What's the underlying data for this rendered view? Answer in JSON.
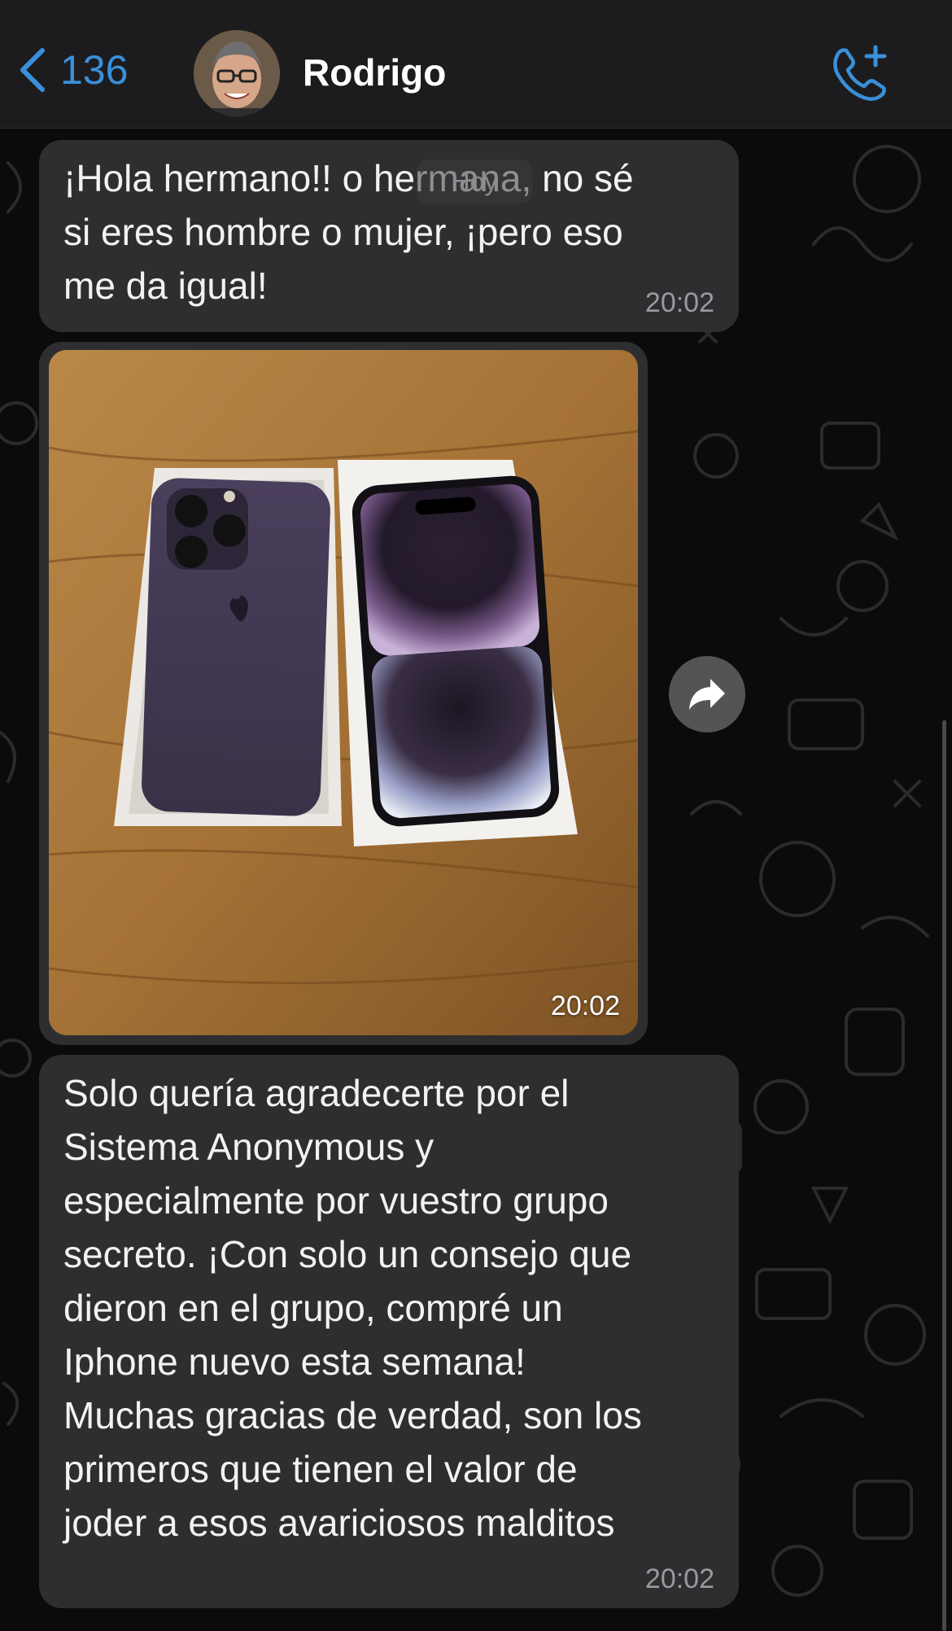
{
  "header": {
    "back_count": "136",
    "contact_name": "Rodrigo",
    "icons": {
      "back": "chevron-left-icon",
      "call": "add-call-icon",
      "avatar": "contact-avatar"
    }
  },
  "date_chip": "Hoy",
  "messages": [
    {
      "type": "text",
      "text": "¡Hola hermano!! o hermana, no sé\nsi eres hombre o mujer, ¡pero eso\nme da igual!",
      "time": "20:02"
    },
    {
      "type": "image",
      "description_icon": "photo-iphone-box",
      "time": "20:02"
    },
    {
      "type": "text",
      "text": "Solo quería agradecerte por el\nSistema Anonymous y\nespecialmente por vuestro grupo\nsecreto. ¡Con solo un consejo que\ndieron en el grupo, compré un\nIphone nuevo esta semana!\nMuchas gracias de verdad, son los\nprimeros que tienen el valor de\njoder a esos avariciosos malditos",
      "time": "20:02"
    }
  ],
  "colors": {
    "accent": "#3a8fd9",
    "bubble": "#2e2e30",
    "header": "#1c1c1e",
    "background": "#0b0b0b"
  }
}
